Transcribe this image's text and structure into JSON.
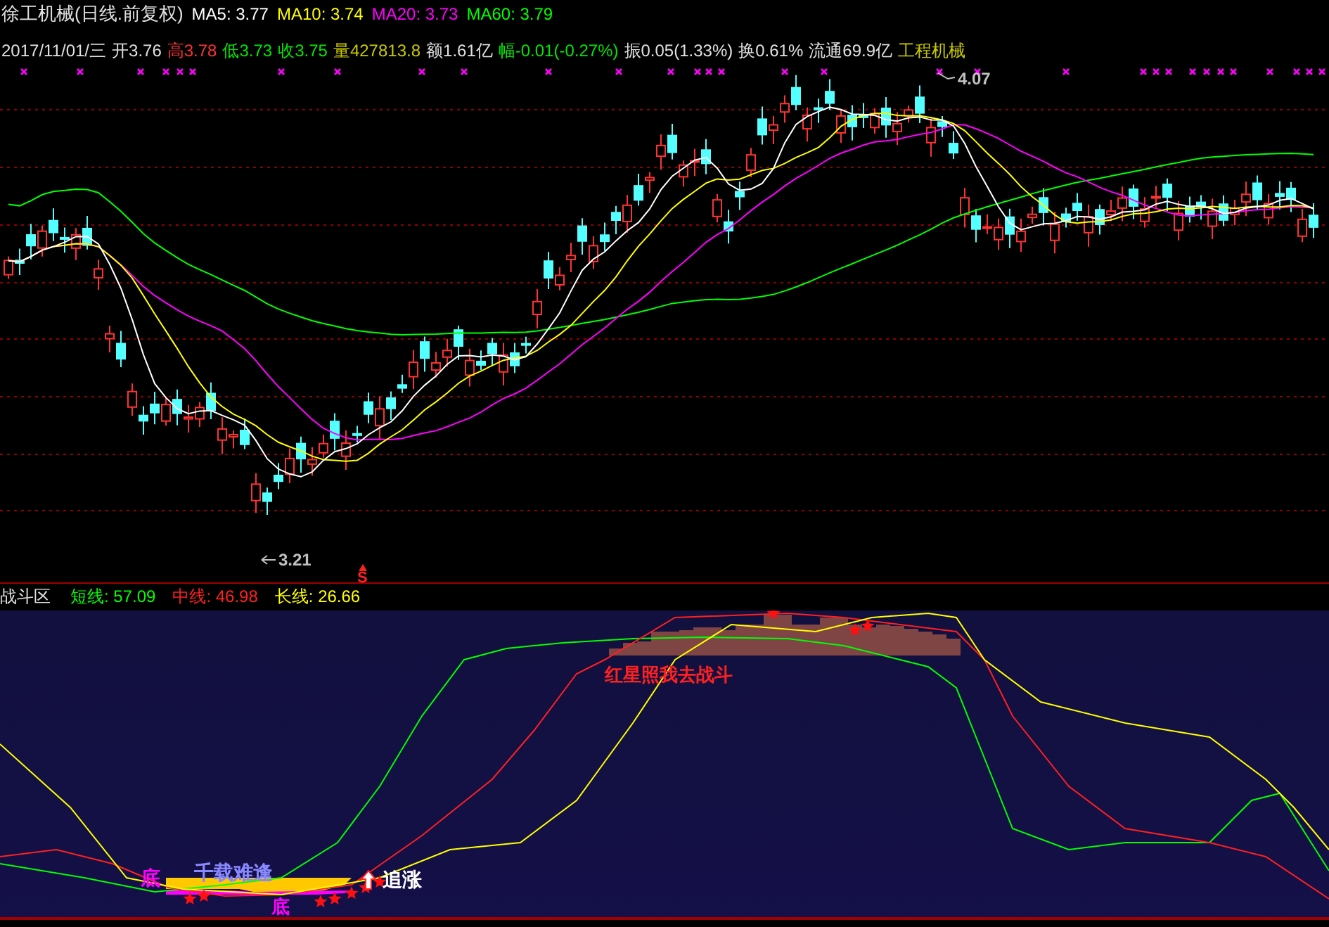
{
  "header": {
    "title": "徐工机械(日线.前复权)",
    "moving_averages": [
      {
        "text": "MA5: 3.77",
        "color": "#ffffff"
      },
      {
        "text": "MA10: 3.74",
        "color": "#ffff00"
      },
      {
        "text": "MA20: 3.73",
        "color": "#ff00ff"
      },
      {
        "text": "MA60: 3.79",
        "color": "#00ff00"
      }
    ]
  },
  "quote_bar": {
    "date": "2017/11/01/三",
    "items": [
      {
        "text": "开3.76",
        "color": "#e0e0e0"
      },
      {
        "text": "高3.78",
        "color": "#ff3232"
      },
      {
        "text": "低3.73",
        "color": "#00e600"
      },
      {
        "text": "收3.75",
        "color": "#00e600"
      },
      {
        "text": "量427813.8",
        "color": "#c8c800"
      },
      {
        "text": "额1.61亿",
        "color": "#e0e0e0"
      },
      {
        "text": "幅-0.01(-0.27%)",
        "color": "#00e600"
      },
      {
        "text": "振0.05(1.33%)",
        "color": "#e0e0e0"
      },
      {
        "text": "换0.61%",
        "color": "#e0e0e0"
      },
      {
        "text": "流通69.9亿",
        "color": "#e0e0e0"
      },
      {
        "text": "工程机械",
        "color": "#c8c800"
      }
    ]
  },
  "price_chart": {
    "high_marker": "4.07",
    "low_marker": "3.21",
    "signal": "S"
  },
  "indicator": {
    "title": "战斗区",
    "values": [
      {
        "text": "短线: 57.09",
        "color": "#00ff00"
      },
      {
        "text": "中线: 46.98",
        "color": "#ff2020"
      },
      {
        "text": "长线: 26.66",
        "color": "#ffff00"
      }
    ],
    "labels": [
      {
        "text": "红星照我去战斗",
        "color": "#ff2020"
      },
      {
        "text": "底",
        "color": "#ff00ff"
      },
      {
        "text": "千载难逢",
        "color": "#8888ff"
      },
      {
        "text": "追涨",
        "color": "#ffffff"
      },
      {
        "text": "底",
        "color": "#ff00ff"
      }
    ]
  }
}
